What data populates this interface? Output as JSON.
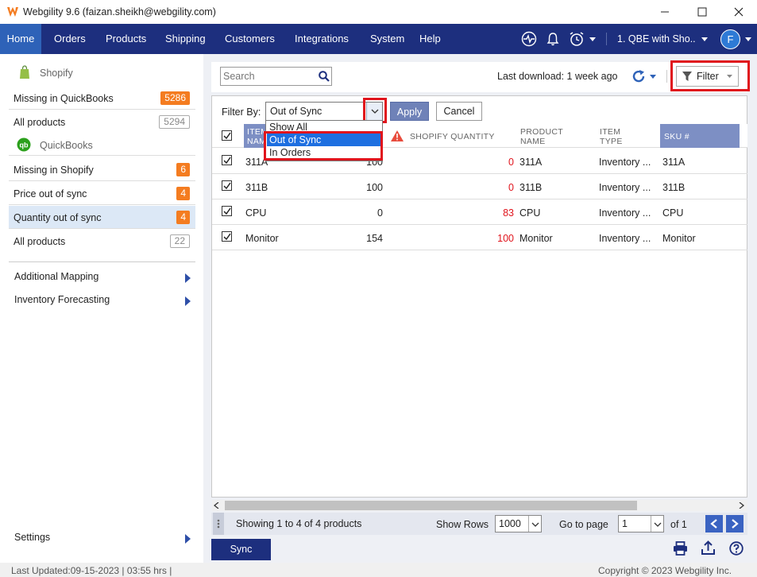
{
  "window": {
    "title": "Webgility 9.6 (faizan.sheikh@webgility.com)"
  },
  "nav": {
    "items": [
      "Home",
      "Orders",
      "Products",
      "Shipping",
      "Customers",
      "Integrations",
      "System",
      "Help"
    ],
    "company": "1. QBE with Sho..",
    "avatar_letter": "F"
  },
  "sidebar": {
    "store_name": "Shopify",
    "store_rows": [
      {
        "label": "Missing in QuickBooks",
        "count": "5286"
      },
      {
        "label": "All products",
        "count": "5294"
      }
    ],
    "accounting_name": "QuickBooks",
    "accounting_rows": [
      {
        "label": "Missing in Shopify",
        "count": "6"
      },
      {
        "label": "Price out of sync",
        "count": "4"
      },
      {
        "label": "Quantity out of sync",
        "count": "4"
      },
      {
        "label": "All products",
        "count": "22"
      }
    ],
    "links": [
      "Additional Mapping",
      "Inventory Forecasting"
    ],
    "settings": "Settings"
  },
  "toolbar": {
    "search_placeholder": "Search",
    "last_download": "Last download: 1 week ago",
    "filter_label": "Filter"
  },
  "filter_bar": {
    "label": "Filter By:",
    "selected": "Out of Sync",
    "options": [
      "Show All",
      "Out of Sync",
      "In Orders"
    ],
    "apply": "Apply",
    "cancel": "Cancel"
  },
  "table": {
    "headers": {
      "item_name_1": "ITEM",
      "item_name_2": "NAME",
      "shopify_qty": "SHOPIFY QUANTITY",
      "product_name_1": "PRODUCT",
      "product_name_2": "NAME",
      "item_type_1": "ITEM",
      "item_type_2": "TYPE",
      "sku": "SKU #"
    },
    "rows": [
      {
        "item": "311A",
        "qb_qty": "100",
        "shopify_qty": "0",
        "product": "311A",
        "type": "Inventory ...",
        "sku": "311A"
      },
      {
        "item": "311B",
        "qb_qty": "100",
        "shopify_qty": "0",
        "product": "311B",
        "type": "Inventory ...",
        "sku": "311B"
      },
      {
        "item": "CPU",
        "qb_qty": "0",
        "shopify_qty": "83",
        "product": "CPU",
        "type": "Inventory ...",
        "sku": "CPU"
      },
      {
        "item": "Monitor",
        "qb_qty": "154",
        "shopify_qty": "100",
        "product": "Monitor",
        "type": "Inventory ...",
        "sku": "Monitor"
      }
    ]
  },
  "pager": {
    "showing": "Showing 1 to 4 of 4 products",
    "show_rows_label": "Show Rows",
    "rows_value": "1000",
    "goto_label": "Go to page",
    "page_value": "1",
    "of_pages": "of 1"
  },
  "actions": {
    "sync": "Sync"
  },
  "status": {
    "last_updated": "Last Updated:09-15-2023 | 03:55 hrs |",
    "copyright": "Copyright © 2023 Webgility Inc."
  },
  "colors": {
    "nav_bg": "#1d2f7e",
    "nav_active": "#2e62b8",
    "badge": "#f47c20",
    "highlight": "#e0141c",
    "selection": "#1e6fe0"
  }
}
